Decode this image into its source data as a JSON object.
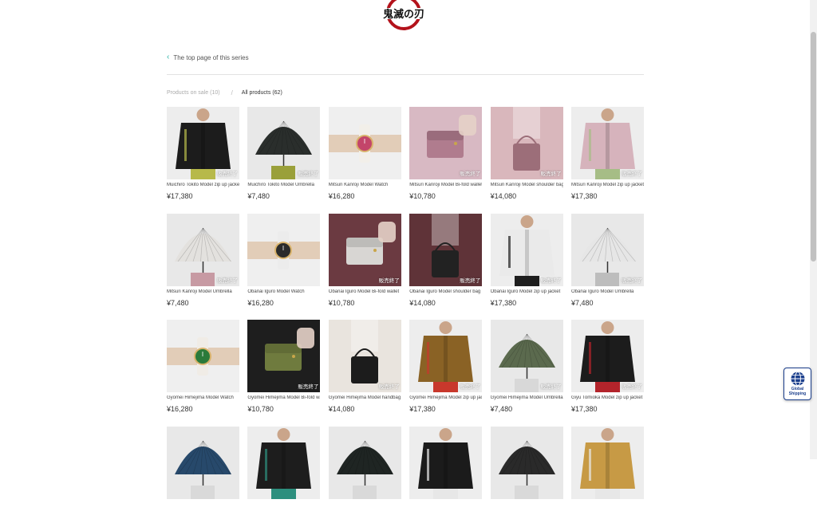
{
  "header": {
    "logo_alt": "鬼滅の刃"
  },
  "back_link": {
    "label": "The top page of this series",
    "icon": "chevron-left-icon"
  },
  "filter": {
    "on_sale_label": "Products on sale",
    "on_sale_count": "(10)",
    "separator": "/",
    "all_label": "All products",
    "all_count": "(62)"
  },
  "sold_out_label": "販売終了",
  "products": [
    {
      "name": "Muichiro Tokito Model zip up jacket",
      "price": "¥17,380",
      "sold_out": true,
      "kind": "jacket",
      "colors": [
        "#1c1c1c",
        "#b7b94a"
      ]
    },
    {
      "name": "Muichiro Tokito Model Umbrella",
      "price": "¥7,480",
      "sold_out": true,
      "kind": "umbrella",
      "colors": [
        "#2a2e2c",
        "#9aa03a"
      ]
    },
    {
      "name": "Mitsuri Kanroji Model Watch",
      "price": "¥16,280",
      "sold_out": false,
      "kind": "watch",
      "colors": [
        "#f2efe9",
        "#c3456a"
      ]
    },
    {
      "name": "Mitsuri Kanroji Model Bi-fold wallet",
      "price": "¥10,780",
      "sold_out": true,
      "kind": "wallet",
      "colors": [
        "#d8b9c3",
        "#b07c8e"
      ]
    },
    {
      "name": "Mitsuri Kanroji Model shoulder bag",
      "price": "¥14,080",
      "sold_out": true,
      "kind": "bag",
      "colors": [
        "#d9b7bc",
        "#9c6e79"
      ]
    },
    {
      "name": "Mitsuri Kanroji Model zip up jacket",
      "price": "¥17,380",
      "sold_out": true,
      "kind": "jacket",
      "colors": [
        "#d6b3bc",
        "#a6bd86"
      ]
    },
    {
      "name": "Mitsuri Kanroji Model Umbrella",
      "price": "¥7,480",
      "sold_out": true,
      "kind": "umbrella",
      "colors": [
        "#e3e1de",
        "#c79aa3"
      ]
    },
    {
      "name": "Obanai Iguro Model Watch",
      "price": "¥16,280",
      "sold_out": false,
      "kind": "watch",
      "colors": [
        "#ececec",
        "#2b2b2b"
      ]
    },
    {
      "name": "Obanai Iguro Model Bi-fold wallet",
      "price": "¥10,780",
      "sold_out": true,
      "kind": "wallet",
      "colors": [
        "#6b3a41",
        "#d8d6d3"
      ]
    },
    {
      "name": "Obanai Iguro Model shoulder bag",
      "price": "¥14,080",
      "sold_out": true,
      "kind": "bag",
      "colors": [
        "#5f3338",
        "#222222"
      ]
    },
    {
      "name": "Obanai Iguro Model zip up jacket",
      "price": "¥17,380",
      "sold_out": true,
      "kind": "jacket",
      "colors": [
        "#eaeaea",
        "#1e1e1e"
      ]
    },
    {
      "name": "Obanai Iguro Model Umbrella",
      "price": "¥7,480",
      "sold_out": true,
      "kind": "umbrella",
      "colors": [
        "#e6e6e6",
        "#bdbdbd"
      ]
    },
    {
      "name": "Gyomei Himejima Model Watch",
      "price": "¥16,280",
      "sold_out": false,
      "kind": "watch",
      "colors": [
        "#f0ece6",
        "#2a7a3a"
      ]
    },
    {
      "name": "Gyomei Himejima Model Bi-fold wallet",
      "price": "¥10,780",
      "sold_out": true,
      "kind": "wallet",
      "colors": [
        "#1e1e1e",
        "#6f7b3e"
      ]
    },
    {
      "name": "Gyomei Himejima Model handbag",
      "price": "¥14,080",
      "sold_out": true,
      "kind": "bag",
      "colors": [
        "#e9e4de",
        "#1c1c1c"
      ]
    },
    {
      "name": "Gyomei Himejima Model zip up jacket",
      "price": "¥17,380",
      "sold_out": true,
      "kind": "jacket",
      "colors": [
        "#8a6225",
        "#c8382c"
      ]
    },
    {
      "name": "Gyomei Himejima Model Umbrella",
      "price": "¥7,480",
      "sold_out": true,
      "kind": "umbrella",
      "colors": [
        "#5b6a4e",
        "#d8d8d8"
      ]
    },
    {
      "name": "Giyu Tomioka Model zip up jacket",
      "price": "¥17,380",
      "sold_out": true,
      "kind": "jacket",
      "colors": [
        "#1c1c1c",
        "#b3242b"
      ]
    },
    {
      "name": "",
      "price": "",
      "sold_out": false,
      "kind": "umbrella",
      "colors": [
        "#27496b",
        "#d9d9d9"
      ]
    },
    {
      "name": "",
      "price": "",
      "sold_out": false,
      "kind": "jacket",
      "colors": [
        "#1d1d1d",
        "#2d8f7e"
      ]
    },
    {
      "name": "",
      "price": "",
      "sold_out": false,
      "kind": "umbrella",
      "colors": [
        "#1f2523",
        "#d9d9d9"
      ]
    },
    {
      "name": "",
      "price": "",
      "sold_out": false,
      "kind": "jacket",
      "colors": [
        "#1b1b1b",
        "#e7e7e7"
      ]
    },
    {
      "name": "",
      "price": "",
      "sold_out": false,
      "kind": "umbrella",
      "colors": [
        "#2a2a2a",
        "#d9d9d9"
      ]
    },
    {
      "name": "",
      "price": "",
      "sold_out": false,
      "kind": "jacket",
      "colors": [
        "#c79a45",
        "#e7e7e7"
      ]
    }
  ],
  "global_shipping": {
    "line1": "Global",
    "line2": "Shipping",
    "icon": "globe-icon"
  },
  "colors": {
    "accent": "#2bb3a6",
    "logo_red": "#b3121b",
    "badge_blue": "#1a3e8c"
  }
}
